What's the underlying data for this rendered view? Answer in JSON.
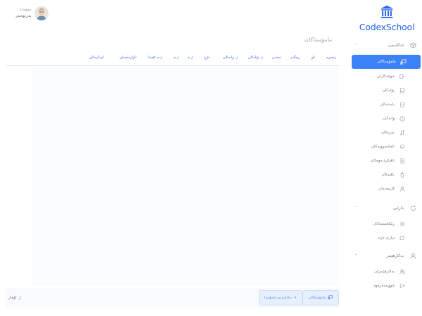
{
  "brand": {
    "name": "CodexSchool",
    "icon": "building-columns-icon",
    "color": "#2563eb"
  },
  "user": {
    "role": "Codex",
    "name": "بەڕێوەبەر",
    "avatar": "avatar-icon"
  },
  "sidebar": {
    "sections": [
      {
        "label": "ئەکادیمی",
        "icon": "cube-icon"
      },
      {
        "label": "دارایی",
        "icon": "refresh-icon"
      },
      {
        "label": "بەکارهێنەر",
        "icon": "user-icon"
      }
    ],
    "items": [
      {
        "label": "مامۆستاکان",
        "icon": "teacher-board-icon",
        "active": true
      },
      {
        "label": "خوێندکاران",
        "icon": "student-icon"
      },
      {
        "label": "پۆلەکان",
        "icon": "book-icon"
      },
      {
        "label": "بابەتەکان",
        "icon": "clipboard-icon"
      },
      {
        "label": "وانەکان",
        "icon": "clock-icon"
      },
      {
        "label": "نمرەکان",
        "icon": "sort-icon"
      },
      {
        "label": "ئامادەبوونەکان",
        "icon": "bell-icon"
      },
      {
        "label": "تاقیکردنەوەکان",
        "icon": "file-icon"
      },
      {
        "label": "باقیەکان",
        "icon": "bucket-icon"
      },
      {
        "label": "کارمەندان",
        "icon": "person-icon"
      },
      {
        "label": "ڕێکخستنەکان",
        "icon": "gear-icon"
      },
      {
        "label": "دیاری تازە",
        "icon": "chat-icon"
      },
      {
        "label": "بەکارهێنەران",
        "icon": "users-icon"
      },
      {
        "label": "چوونەدەرەوە",
        "icon": "logout-icon"
      }
    ]
  },
  "main": {
    "page_title": "مامۆستاکان",
    "columns": [
      "زنجیرە",
      "ناو",
      "ڕەگەز",
      "تەمەن",
      "ژ. پۆلەکان",
      "ژ. وانەکان",
      "دۆخ",
      "ژ.م",
      "ژ.م",
      "ژ.م ئێستا",
      "ئاوازەشمان",
      "کردارەکان"
    ],
    "footer": {
      "count_label": "ژ. ئۆمار",
      "teachers_button": "مامۆستاکان",
      "add_button": "زیادکردنی مامۆستا"
    }
  },
  "colors": {
    "accent": "#3b82f6",
    "link": "#2563eb"
  }
}
